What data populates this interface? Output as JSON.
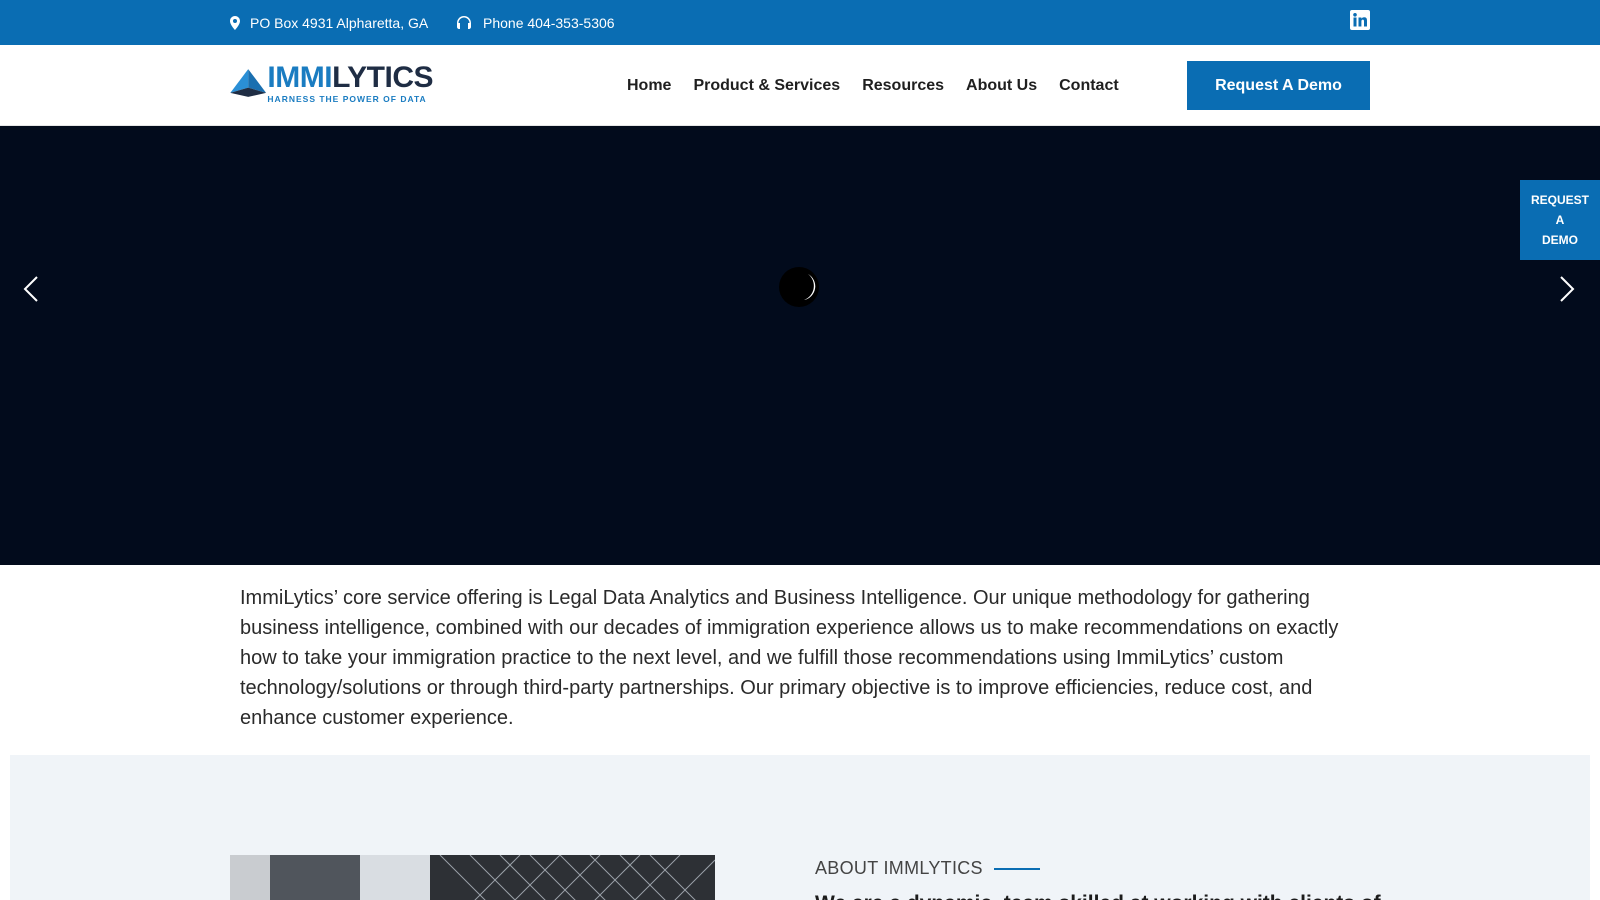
{
  "topbar": {
    "address": "PO Box 4931 Alpharetta, GA",
    "phone": "Phone 404-353-5306",
    "icons": [
      "map-pin-icon",
      "headset-icon",
      "linkedin-icon"
    ]
  },
  "header": {
    "logo": {
      "word_a": "IMMI",
      "word_b": "LYTICS",
      "tagline": "HARNESS THE POWER OF DATA"
    },
    "nav": [
      "Home",
      "Product & Services",
      "Resources",
      "About Us",
      "Contact"
    ],
    "cta": "Request A Demo"
  },
  "side_cta": {
    "line1": "REQUEST",
    "line2": "A",
    "line3": "DEMO"
  },
  "intro": {
    "text": "ImmiLytics’ core service offering is Legal Data Analytics and Business Intelligence. Our unique methodology for gathering business intelligence, combined with our decades of immigration experience allows us to make recommendations on exactly how to take your immigration practice to the next level, and we fulfill those recommendations using ImmiLytics’ custom technology/solutions or through third-party partnerships. Our primary objective is to improve efficiencies, reduce cost, and enhance customer experience."
  },
  "about": {
    "label": "ABOUT IMMLYTICS",
    "heading": "We are a dynamic, team skilled at working with clients of"
  },
  "colors": {
    "brand": "#0a6db3",
    "hero_bg": "#020b1c",
    "about_bg": "#f0f4f8",
    "logo_dark": "#1f2d44"
  }
}
